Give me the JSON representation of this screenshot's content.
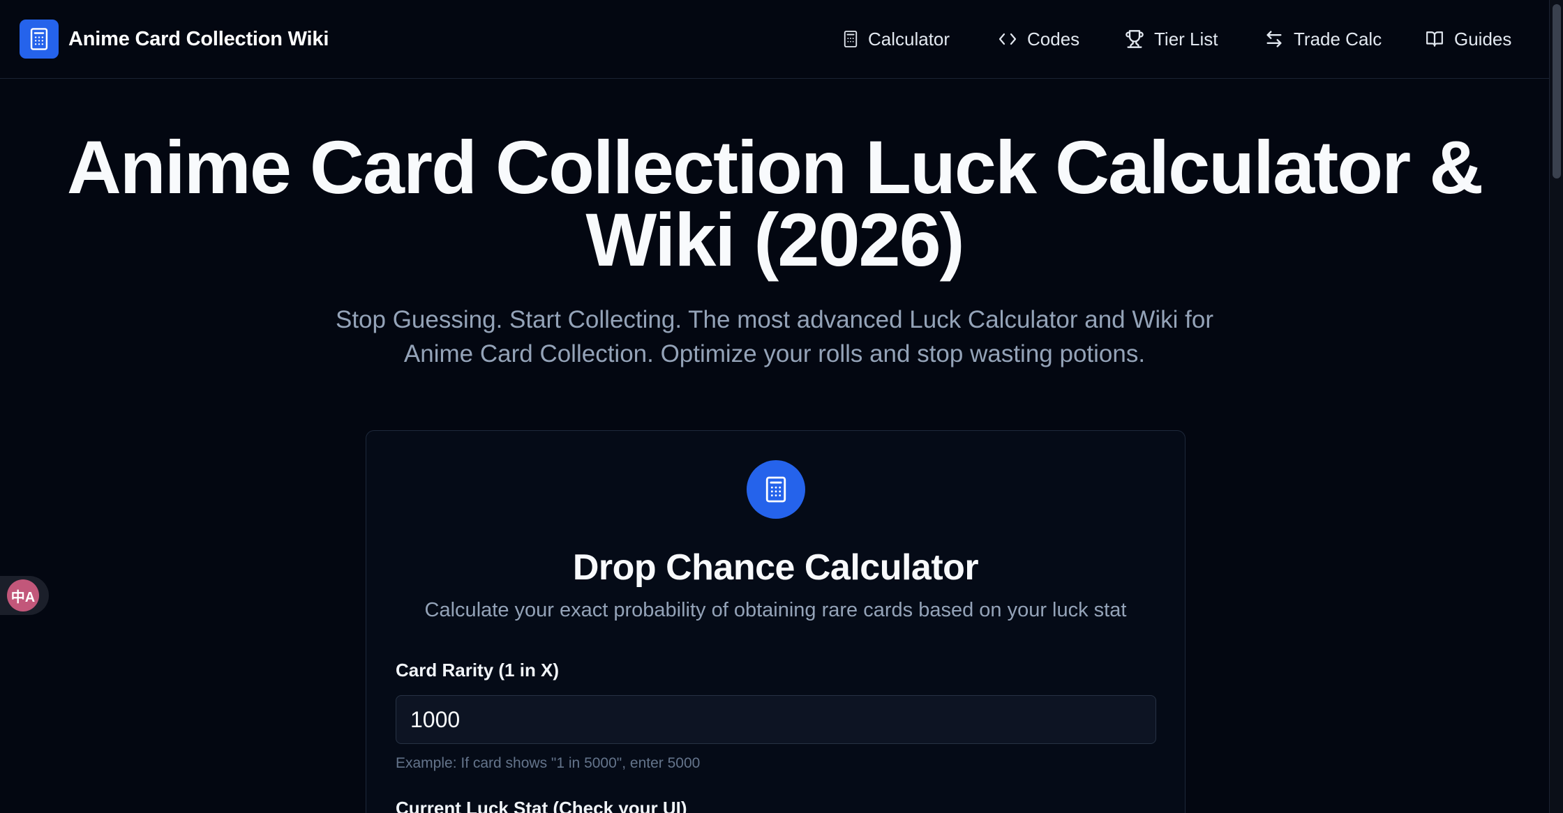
{
  "header": {
    "brand": {
      "name": "Anime Card Collection Wiki",
      "logo_icon": "calculator-icon"
    },
    "nav": [
      {
        "label": "Calculator",
        "icon": "calculator-icon"
      },
      {
        "label": "Codes",
        "icon": "code-icon"
      },
      {
        "label": "Tier List",
        "icon": "trophy-icon"
      },
      {
        "label": "Trade Calc",
        "icon": "arrows-left-right-icon"
      },
      {
        "label": "Guides",
        "icon": "book-open-icon"
      }
    ]
  },
  "hero": {
    "title_line1": "Anime Card Collection Luck Calculator &",
    "title_line2": "Wiki (2026)",
    "subtitle_line1": "Stop Guessing. Start Collecting. The most advanced Luck Calculator and Wiki for",
    "subtitle_line2": "Anime Card Collection. Optimize your rolls and stop wasting potions."
  },
  "calculator": {
    "icon": "calculator-icon",
    "title": "Drop Chance Calculator",
    "description": "Calculate your exact probability of obtaining rare cards based on your luck stat",
    "rarity_label": "Card Rarity (1 in X)",
    "rarity_value": "1000",
    "rarity_hint": "Example: If card shows \"1 in 5000\", enter 5000",
    "luck_label": "Current Luck Stat (Check your UI)"
  },
  "translate_widget": {
    "icon": "translate-icon",
    "glyph": "中A"
  },
  "colors": {
    "background": "#030711",
    "accent": "#2563eb",
    "muted_text": "#94a3b8",
    "card_border": "#1e293b"
  }
}
